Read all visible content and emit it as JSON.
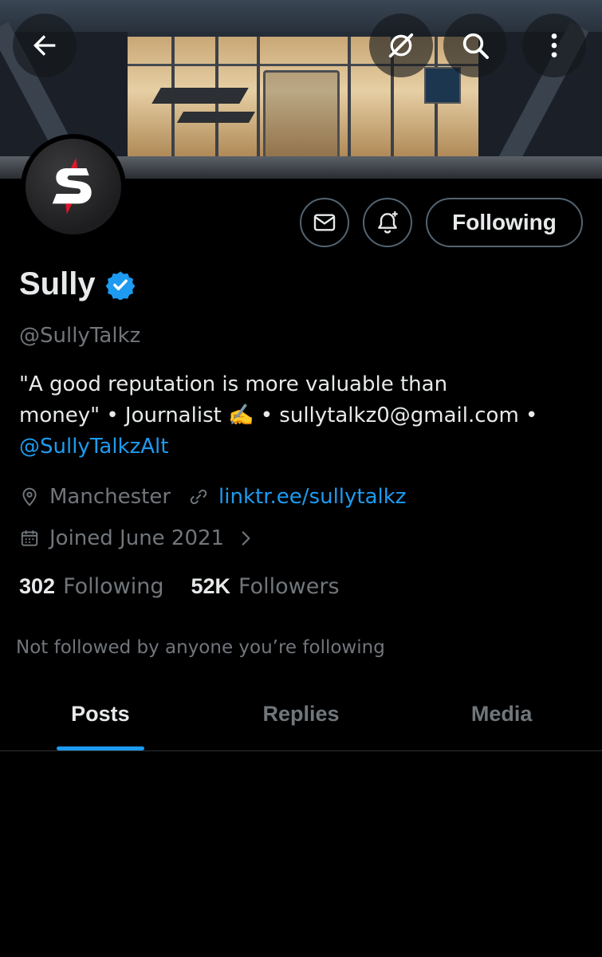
{
  "header": {
    "back_icon": "arrow-left-icon",
    "grok_icon": "grok-icon",
    "search_icon": "search-icon",
    "more_icon": "more-vertical-icon"
  },
  "profile": {
    "name": "Sully",
    "handle": "@SullyTalkz",
    "verified": true,
    "bio_line1": "\"A good reputation is more valuable than",
    "bio_line2": "money\" • Journalist ✍️ • sullytalkz0@gmail.com •",
    "bio_mention": "@SullyTalkzAlt",
    "location": "Manchester",
    "website": "linktr.ee/sullytalkz",
    "joined": "Joined June 2021",
    "following_count": "302",
    "following_label": "Following",
    "followers_count": "52K",
    "followers_label": "Followers",
    "not_followed_text": "Not followed by anyone you’re following"
  },
  "actions": {
    "message_icon": "envelope-icon",
    "notify_icon": "bell-plus-icon",
    "follow_label": "Following"
  },
  "tabs": [
    {
      "label": "Posts",
      "active": true
    },
    {
      "label": "Replies",
      "active": false
    },
    {
      "label": "Media",
      "active": false
    }
  ],
  "colors": {
    "accent": "#1d9bf0",
    "background": "#000000",
    "secondary_text": "#71767b",
    "border": "#536471"
  }
}
